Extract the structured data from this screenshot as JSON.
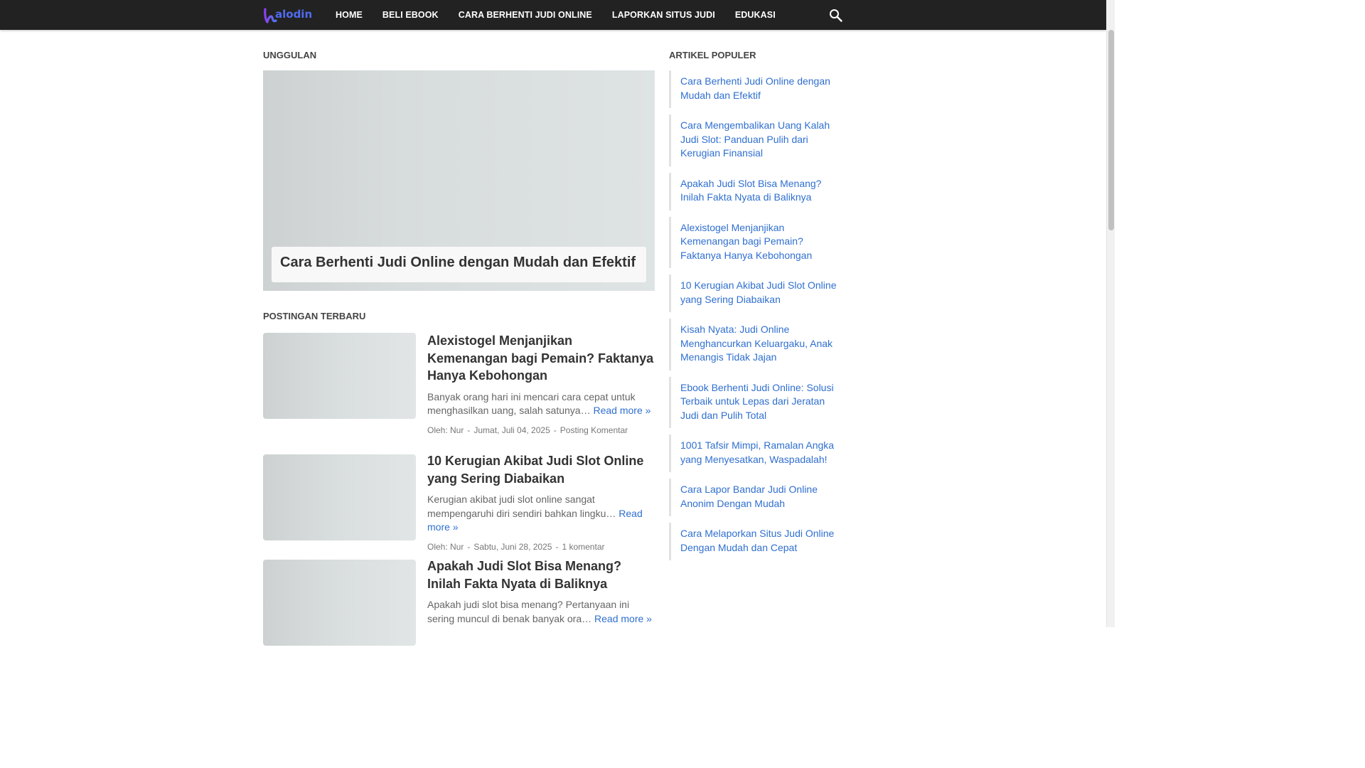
{
  "header": {
    "logo_text": "halodin",
    "nav": [
      {
        "label": "HOME"
      },
      {
        "label": "BELI EBOOK"
      },
      {
        "label": "CARA BERHENTI JUDI ONLINE"
      },
      {
        "label": "LAPORKAN SITUS JUDI"
      },
      {
        "label": "EDUKASI"
      }
    ],
    "search_icon": "search-icon"
  },
  "featured": {
    "section_title": "UNGGULAN",
    "title": "Cara Berhenti Judi Online dengan Mudah dan Efektif"
  },
  "recent": {
    "section_title": "POSTINGAN TERBARU",
    "posts": [
      {
        "title": "Alexistogel Menjanjikan Kemenangan bagi Pemain? Faktanya Hanya Kebohongan",
        "snippet": "Banyak orang hari ini mencari cara cepat untuk menghasilkan uang, salah satunya…",
        "read_more": "Read more »",
        "author": "Oleh: Nur",
        "date": "Jumat, Juli 04, 2025",
        "comments": "Posting Komentar"
      },
      {
        "title": "10 Kerugian Akibat Judi Slot Online yang Sering Diabaikan",
        "snippet": "Kerugian akibat judi slot online sangat mempengaruhi diri sendiri bahkan lingku…",
        "read_more": "Read more »",
        "author": "Oleh: Nur",
        "date": "Sabtu, Juni 28, 2025",
        "comments": "1 komentar"
      },
      {
        "title": "Apakah Judi Slot Bisa Menang? Inilah Fakta Nyata di Baliknya",
        "snippet": "Apakah judi slot bisa menang? Pertanyaan ini sering muncul di benak banyak ora…",
        "read_more": "Read more »"
      }
    ]
  },
  "sidebar": {
    "title": "ARTIKEL POPULER",
    "items": [
      {
        "label": "Cara Berhenti Judi Online dengan Mudah dan Efektif"
      },
      {
        "label": "Cara Mengembalikan Uang Kalah Judi Slot: Panduan Pulih dari Kerugian Finansial"
      },
      {
        "label": "Apakah Judi Slot Bisa Menang? Inilah Fakta Nyata di Baliknya"
      },
      {
        "label": "Alexistogel Menjanjikan Kemenangan bagi Pemain? Faktanya Hanya Kebohongan"
      },
      {
        "label": "10 Kerugian Akibat Judi Slot Online yang Sering Diabaikan"
      },
      {
        "label": "Kisah Nyata: Judi Online Menghancurkan Keluargaku, Anak Menangis Tidak Jajan"
      },
      {
        "label": "Ebook Berhenti Judi Online: Solusi Terbaik untuk Lepas dari Jeratan Judi dan Pulih Total"
      },
      {
        "label": "1001 Tafsir Mimpi, Ramalan Angka yang Menyesatkan, Waspadalah!"
      },
      {
        "label": "Cara Lapor Bandar Judi Online Anonim Dengan Mudah"
      },
      {
        "label": "Cara Melaporkan Situs Judi Online Dengan Mudah dan Cepat"
      }
    ]
  },
  "colors": {
    "header_bg": "#222222",
    "link": "#2f6fd0",
    "logo_primary": "#4f6bf0",
    "logo_accent": "#8a3ff0"
  }
}
